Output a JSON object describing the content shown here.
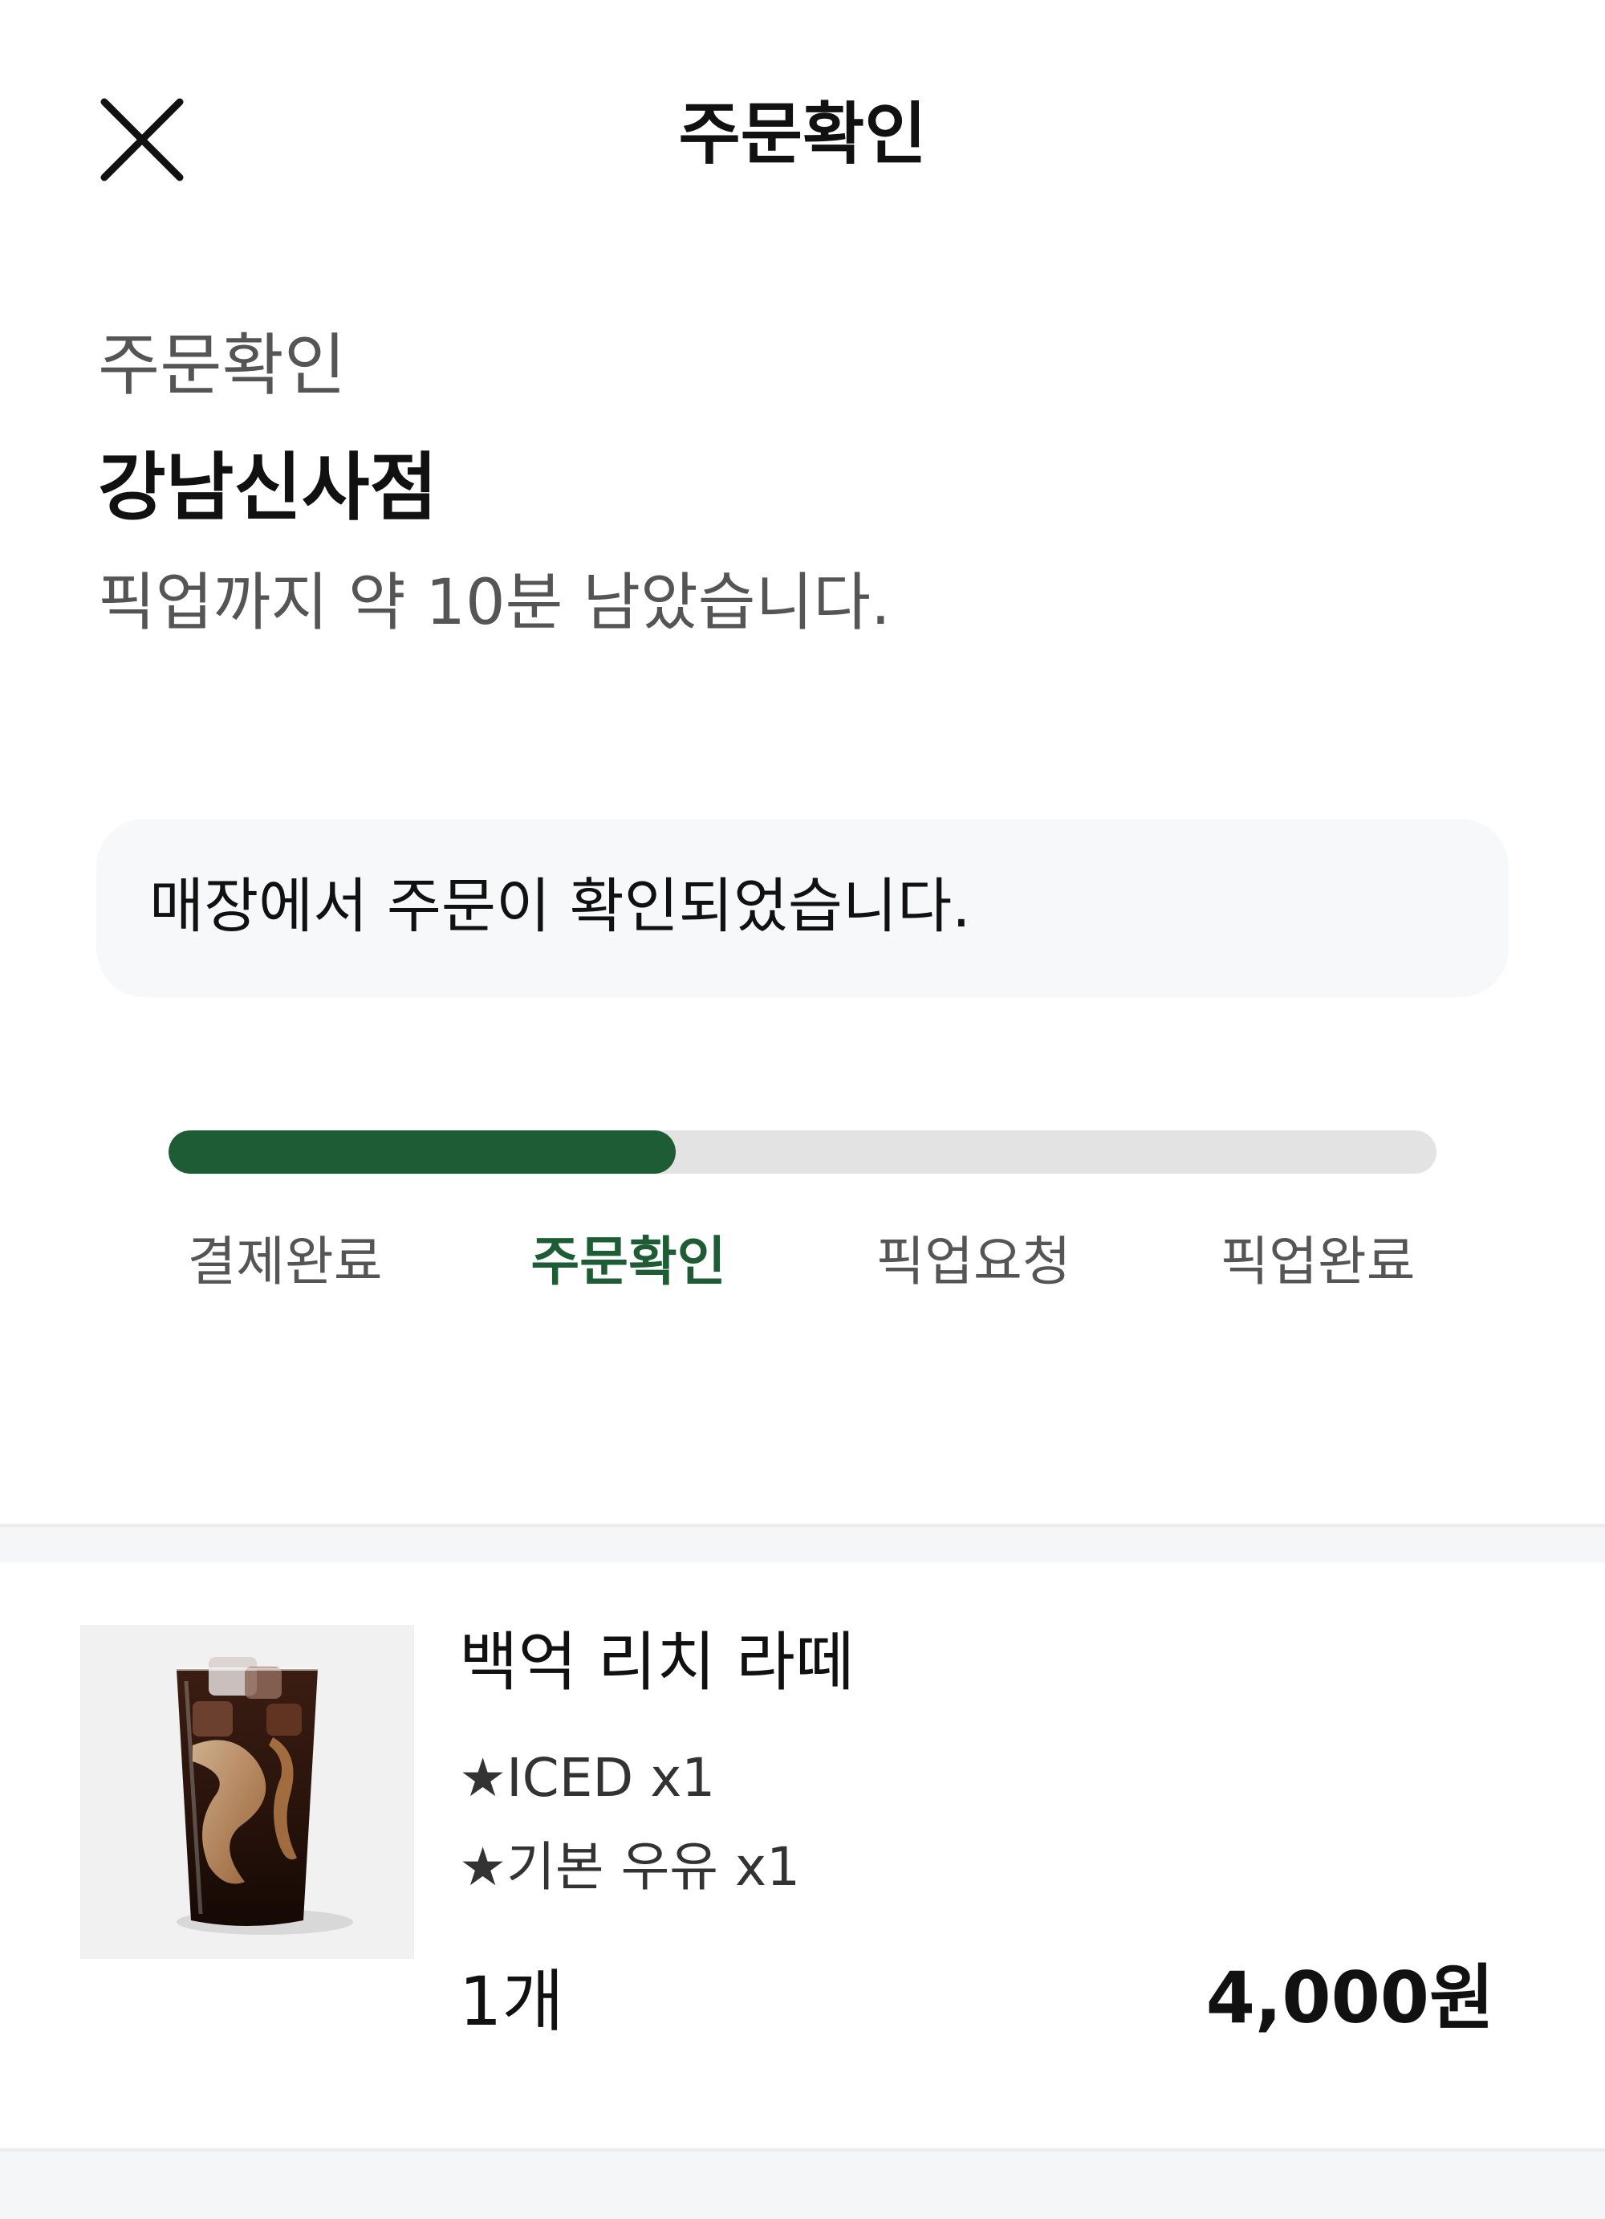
{
  "header": {
    "title": "주문확인",
    "close_icon": "close-icon"
  },
  "status": {
    "label": "주문확인",
    "store_name": "강남신사점",
    "pickup_eta": "픽업까지 약 10분 남았습니다."
  },
  "notice": {
    "message": "매장에서 주문이 확인되었습니다."
  },
  "progress": {
    "fill_fraction": 0.4,
    "active_step_index": 1,
    "accent_color": "#1e5c35",
    "steps": [
      {
        "label": "결제완료"
      },
      {
        "label": "주문확인"
      },
      {
        "label": "픽업요청"
      },
      {
        "label": "픽업완료"
      }
    ]
  },
  "order": {
    "items": [
      {
        "name": "백억 리치 라떼",
        "options": [
          "★ICED x1",
          "★기본 우유 x1"
        ],
        "quantity": "1개",
        "price": "4,000원",
        "thumbnail_icon": "iced-latte-image"
      }
    ]
  }
}
